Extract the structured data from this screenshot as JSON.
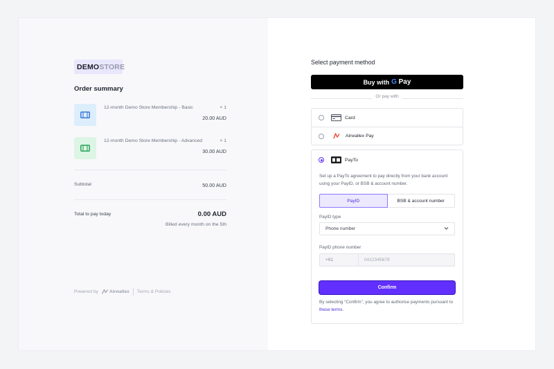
{
  "brand": {
    "logo_part1": "DEMO",
    "logo_part2": "STORE"
  },
  "order": {
    "title": "Order summary",
    "items": [
      {
        "name": "12-month Demo Store Membership - Basic",
        "qty": "× 1",
        "price": "20.00 AUD",
        "icon": "ticket-icon",
        "color": "#2d6fd6"
      },
      {
        "name": "12-month Demo Store Membership - Advanced",
        "qty": "× 1",
        "price": "30.00 AUD",
        "icon": "ticket-icon",
        "color": "#1f9a52"
      }
    ],
    "subtotal_label": "Subtotal",
    "subtotal_value": "50.00 AUD",
    "total_label": "Total to pay today",
    "total_value": "0.00 AUD",
    "billed_note": "Billed every month on the 5th"
  },
  "footer": {
    "powered_by": "Powered by",
    "brand": "Airwallex",
    "terms": "Terms & Policies"
  },
  "payment": {
    "title": "Select payment method",
    "gpay": {
      "buy_with": "Buy with",
      "g": "G",
      "pay": "Pay"
    },
    "or_pay_with": "Or pay with",
    "methods": [
      {
        "label": "Card",
        "icon": "card-icon",
        "selected": false
      },
      {
        "label": "Airwallex Pay",
        "icon": "airwallex-icon",
        "selected": false
      }
    ],
    "payto": {
      "label": "PayTo",
      "icon": "payto-icon",
      "description": "Set up a PayTo agreement to pay directly from your bank account using your PayID, or BSB & account number.",
      "tabs": [
        "PayID",
        "BSB & account number"
      ],
      "payid_type_label": "PayID type",
      "payid_type_value": "Phone number",
      "phone_label": "PayID phone number",
      "country_code": "+61",
      "phone_placeholder": "0412345678",
      "confirm_label": "Confirm",
      "legal_prefix": "By selecting “Confirm”, you agree to authorise payments pursuant to ",
      "legal_link": "these terms",
      "legal_suffix": "."
    },
    "accent": "#612fff"
  }
}
